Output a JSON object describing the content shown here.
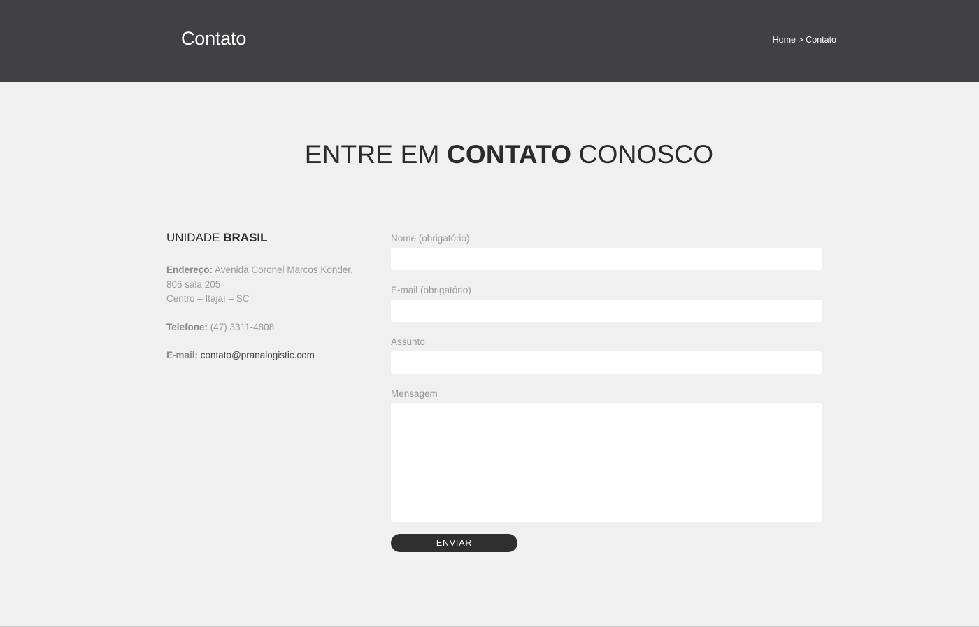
{
  "header": {
    "title": "Contato",
    "breadcrumb": {
      "home": "Home",
      "separator": ">",
      "current": "Contato"
    }
  },
  "section": {
    "heading_pre": "ENTRE EM ",
    "heading_bold": "CONTATO",
    "heading_post": " CONOSCO"
  },
  "unit": {
    "title_pre": "UNIDADE ",
    "title_bold": "BRASIL",
    "address_label": "Endereço:",
    "address_line1": "Avenida Coronel Marcos Konder, 805 sala 205",
    "address_line2": "Centro – Itajaí – SC",
    "phone_label": "Telefone:",
    "phone": "(47) 3311-4808",
    "email_label": "E-mail:",
    "email": "contato@pranalogistic.com"
  },
  "form": {
    "name_label": "Nome (obrigatório)",
    "name_value": "",
    "email_label": "E-mail (obrigatório)",
    "email_value": "",
    "subject_label": "Assunto",
    "subject_value": "",
    "message_label": "Mensagem",
    "message_value": "",
    "submit_label": "ENVIAR"
  },
  "colors": {
    "header_bg": "#414143",
    "page_bg": "#f0f0f0",
    "button_bg": "#2f2f2f",
    "text_dark": "#2b2b2b",
    "text_muted": "#9a9a9a"
  }
}
